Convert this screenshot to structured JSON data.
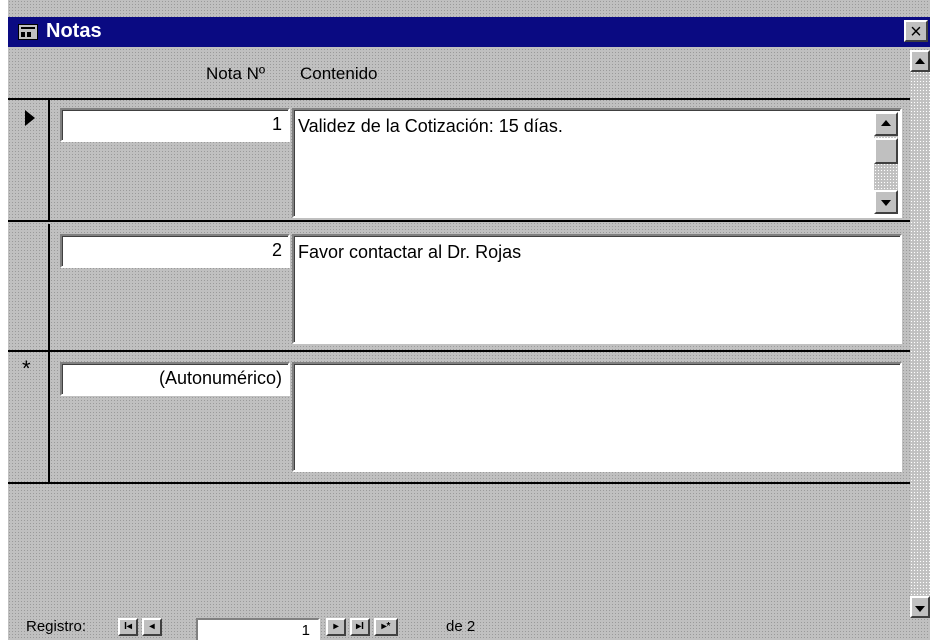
{
  "window": {
    "title": "Notas",
    "close_label": "×"
  },
  "columns": {
    "nota": "Nota Nº",
    "contenido": "Contenido"
  },
  "records": [
    {
      "selector": "current",
      "nota": "1",
      "contenido": "Validez de la Cotización: 15 días."
    },
    {
      "selector": "",
      "nota": "2",
      "contenido": "Favor contactar al Dr. Rojas"
    },
    {
      "selector": "*",
      "nota": "(Autonumérico)",
      "contenido": ""
    }
  ],
  "navigation": {
    "label": "Registro:",
    "first": "I◂",
    "prev": "◂",
    "current_record": "1",
    "next": "▸",
    "last": "▸I",
    "new": "▸*",
    "total": "de  2"
  }
}
